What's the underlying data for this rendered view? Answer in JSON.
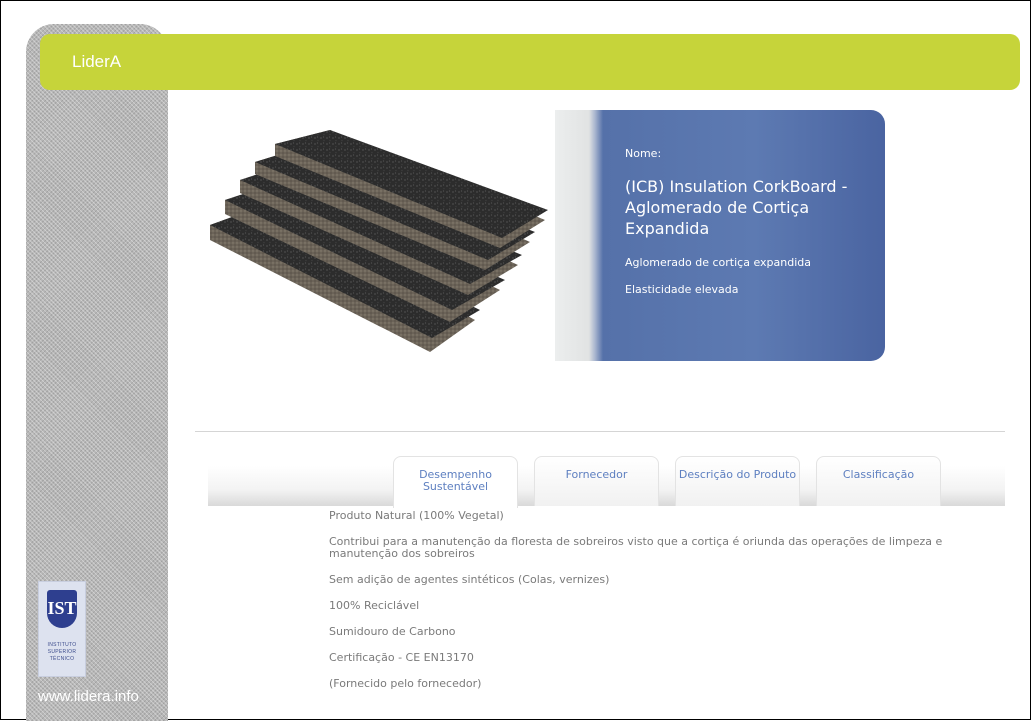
{
  "header": {
    "brand": "LiderA"
  },
  "sidebar": {
    "url": "www.lidera.info",
    "logo_caption": "INSTITUTO SUPERIOR TÉCNICO",
    "logo_mark": "IST"
  },
  "product": {
    "name_label": "Nome:",
    "name": "(ICB) Insulation CorkBoard - Aglomerado de Cortiça Expandida",
    "features": [
      "Aglomerado de cortiça expandida",
      "Elasticidade elevada"
    ]
  },
  "tabs": [
    {
      "label": "Desempenho Sustentável",
      "active": true
    },
    {
      "label": "Fornecedor",
      "active": false
    },
    {
      "label": "Descrição do Produto",
      "active": false
    },
    {
      "label": "Classificação",
      "active": false
    }
  ],
  "details": [
    "Produto Natural (100% Vegetal)",
    "Contribui para a manutenção da floresta de sobreiros visto que a cortiça é oriunda das operações de limpeza e manutenção dos sobreiros",
    "Sem adição de agentes sintéticos (Colas, vernizes)",
    "100% Reciclável",
    "Sumidouro de Carbono",
    "Certificação - CE EN13170",
    "(Fornecido pelo fornecedor)"
  ],
  "colors": {
    "accent": "#c6d43a",
    "card": "#5571a9",
    "tab_text": "#5d7fc0"
  }
}
